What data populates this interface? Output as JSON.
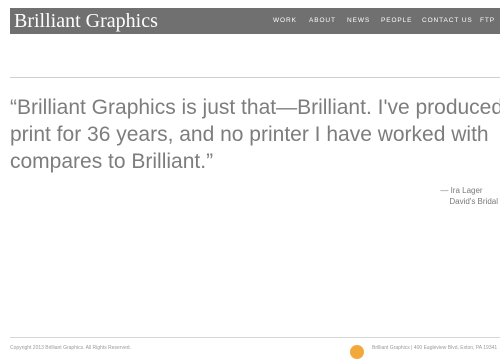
{
  "header": {
    "logo_text": "Brilliant Graphics",
    "nav": {
      "work": "WORK",
      "about": "ABOUT",
      "news": "NEWS",
      "people": "PEOPLE",
      "contact": "CONTACT US",
      "ftp": "FTP"
    }
  },
  "testimonial": {
    "quote_lines": [
      "“Brilliant Graphics is just that—Brilliant. I've produced",
      "print for 36 years, and no printer I have worked with",
      "compares to Brilliant.”"
    ],
    "author": "— Ira Lager",
    "company": "David's Bridal"
  },
  "footer": {
    "copyright": "Copyright 2013 Brilliant Graphics. All Rights Reserved.",
    "address": "Brilliant Graphics | 400 Eagleview Blvd, Exton, PA 19341",
    "logo_icon": "brilliant-graphics-circle-logo-icon"
  },
  "colors": {
    "header_bg": "#707070",
    "quote_text": "#7d7d7d",
    "footer_logo": "#f2a83a"
  }
}
